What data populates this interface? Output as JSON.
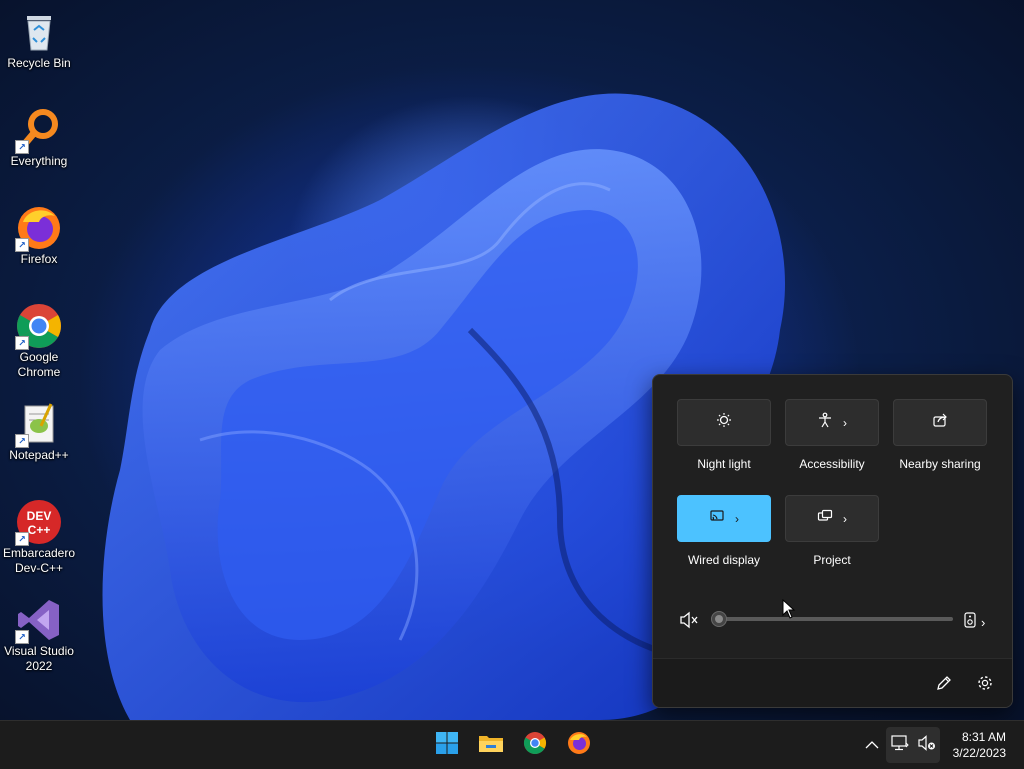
{
  "desktop": {
    "icons": [
      {
        "label": "Recycle Bin"
      },
      {
        "label": "Everything"
      },
      {
        "label": "Firefox"
      },
      {
        "label": "Google Chrome"
      },
      {
        "label": "Notepad++"
      },
      {
        "label": "Embarcadero Dev-C++"
      },
      {
        "label": "Visual Studio 2022"
      }
    ],
    "devcpp_badge": "DEV C++"
  },
  "quick_settings": {
    "tiles": [
      {
        "label": "Night light",
        "icon": "night-light-icon",
        "active": false
      },
      {
        "label": "Accessibility",
        "icon": "accessibility-icon",
        "active": false,
        "has_chevron": true
      },
      {
        "label": "Nearby sharing",
        "icon": "share-icon",
        "active": false
      },
      {
        "label": "Wired display",
        "icon": "cast-icon",
        "active": true,
        "has_chevron": true
      },
      {
        "label": "Project",
        "icon": "project-icon",
        "active": false,
        "has_chevron": true
      }
    ],
    "volume": {
      "level": 0,
      "muted": true
    },
    "accent_color": "#4cc2ff"
  },
  "taskbar": {
    "pinned": [
      "Start",
      "File Explorer",
      "Google Chrome",
      "Firefox"
    ],
    "clock": {
      "time": "8:31 AM",
      "date": "3/22/2023"
    }
  }
}
